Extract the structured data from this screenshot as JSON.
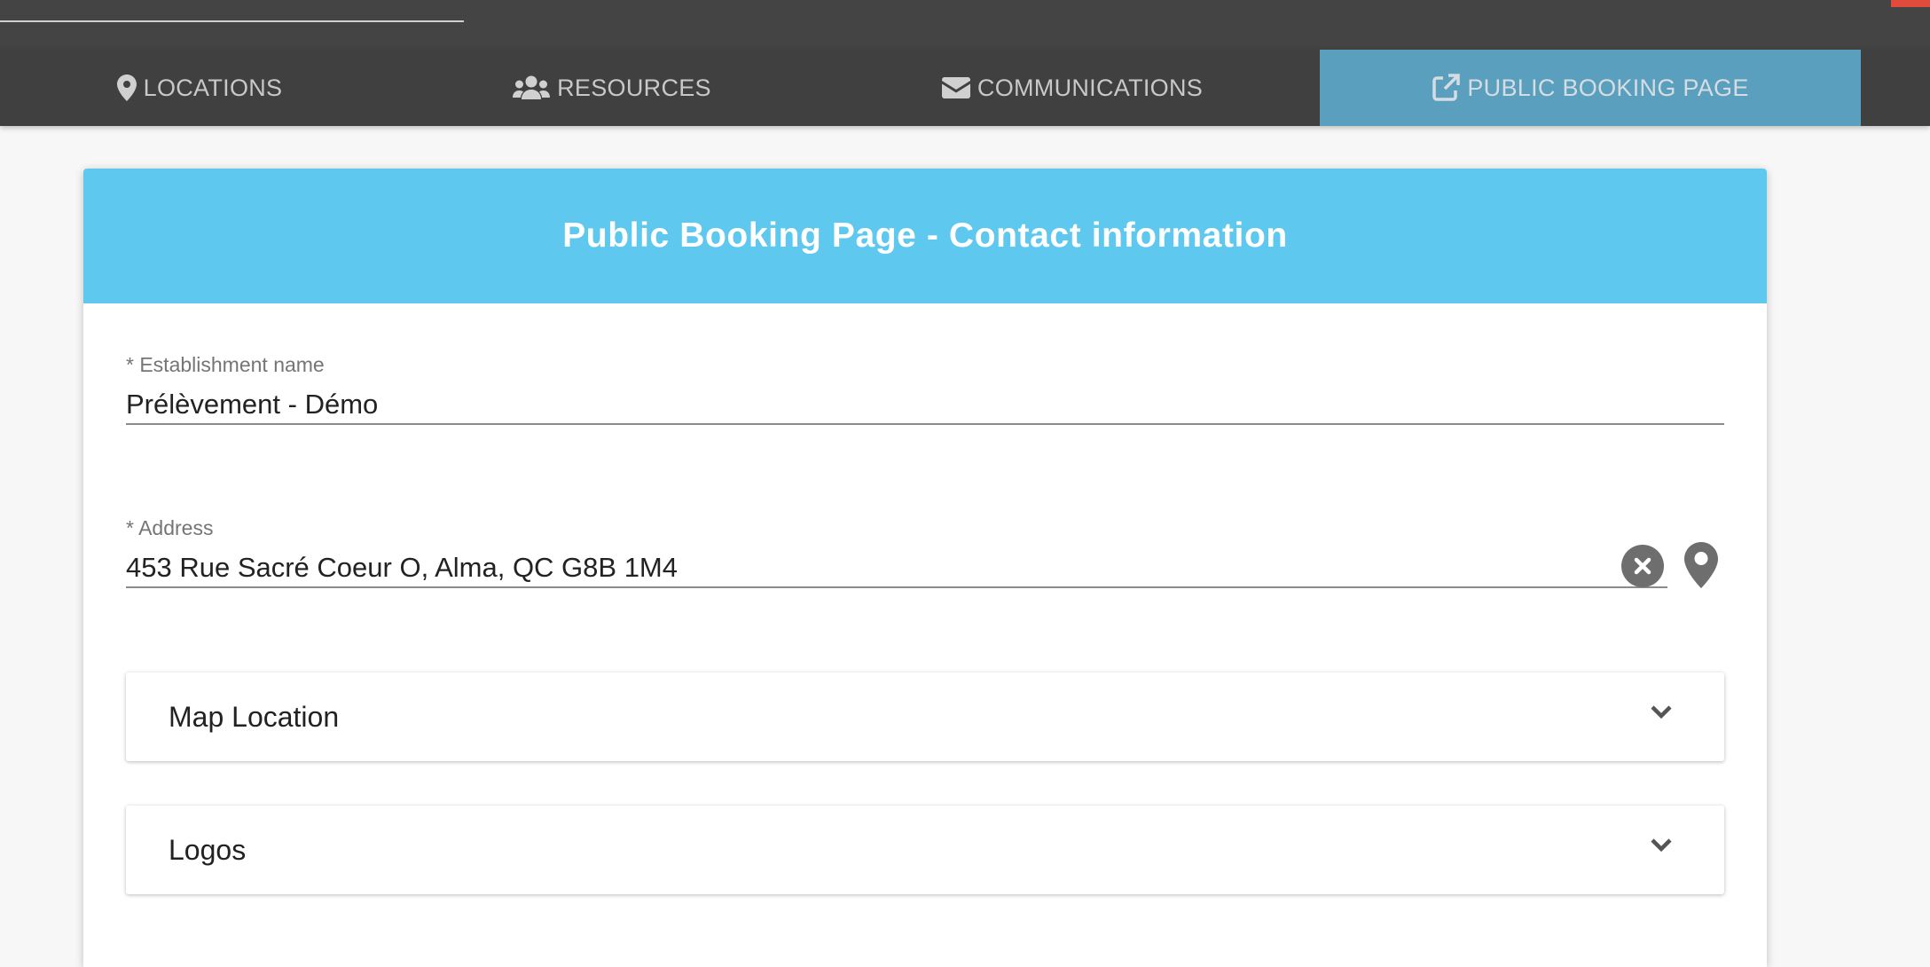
{
  "topbar": {
    "close_color": "#e04b3c"
  },
  "tabs": [
    {
      "label": "LOCATIONS",
      "icon": "map-marker-icon",
      "active": false
    },
    {
      "label": "RESOURCES",
      "icon": "users-icon",
      "active": false
    },
    {
      "label": "COMMUNICATIONS",
      "icon": "envelope-icon",
      "active": false
    },
    {
      "label": "PUBLIC BOOKING PAGE",
      "icon": "external-link-icon",
      "active": true
    }
  ],
  "card": {
    "title": "Public Booking Page - Contact information",
    "header_color": "#5ec8ee"
  },
  "form": {
    "establishment": {
      "label": "* Establishment name",
      "value": "Prélèvement - Démo"
    },
    "address": {
      "label": "* Address",
      "value": "453 Rue Sacré Coeur O, Alma, QC G8B 1M4",
      "clear_icon": "close-circle-icon",
      "locate_icon": "map-marker-icon"
    }
  },
  "panels": [
    {
      "title": "Map Location",
      "icon": "chevron-down-icon"
    },
    {
      "title": "Logos",
      "icon": "chevron-down-icon"
    }
  ],
  "colors": {
    "tabbar": "#404040",
    "active_tab": "#5a9fbe",
    "topbar": "#444444"
  }
}
